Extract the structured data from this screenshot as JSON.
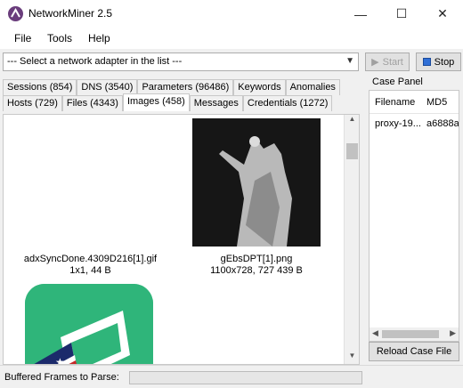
{
  "window": {
    "title": "NetworkMiner 2.5",
    "controls": [
      "—",
      "☐",
      "✕"
    ]
  },
  "menu": [
    "File",
    "Tools",
    "Help"
  ],
  "toolbar": {
    "adapter_placeholder": "--- Select a network adapter in the list ---",
    "start_label": "Start",
    "stop_label": "Stop"
  },
  "tabs": {
    "row1": [
      "Sessions (854)",
      "DNS (3540)",
      "Parameters (96486)",
      "Keywords",
      "Anomalies"
    ],
    "row2": [
      "Hosts (729)",
      "Files (4343)",
      "Images (458)",
      "Messages",
      "Credentials (1272)"
    ],
    "active": "Images (458)"
  },
  "images": [
    {
      "filename": "adxSyncDone.4309D216[1].gif",
      "meta": "1x1, 44 B"
    },
    {
      "filename": "gEbsDPT[1].png",
      "meta": "1100x728, 727 439 B"
    }
  ],
  "case_panel": {
    "label": "Case Panel",
    "columns": [
      "Filename",
      "MD5"
    ],
    "rows": [
      [
        "proxy-19...",
        "a6888a"
      ]
    ],
    "reload_label": "Reload Case File"
  },
  "status": {
    "buffered_label": "Buffered Frames to Parse:",
    "buffered_progress": 0
  },
  "colors": {
    "app_tile": "#2fb57a",
    "title_bar": "#ffffff",
    "chrome": "#f0f0f0"
  }
}
